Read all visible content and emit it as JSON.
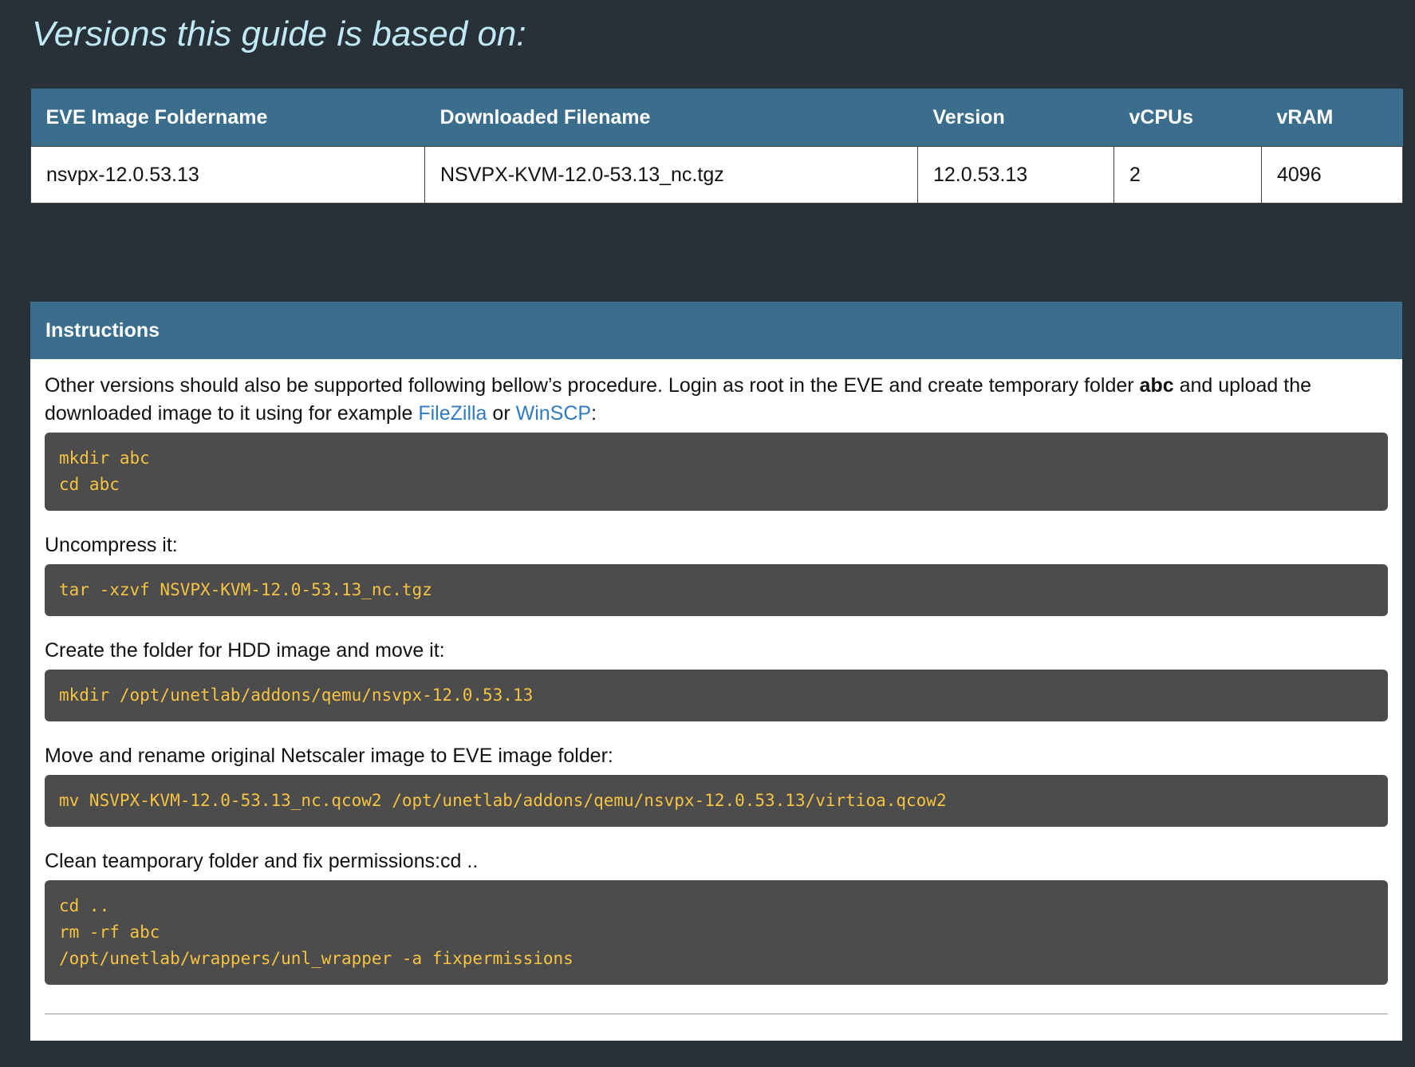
{
  "heading": "Versions this guide is based on:",
  "table": {
    "headers": [
      "EVE Image Foldername",
      "Downloaded Filename",
      "Version",
      "vCPUs",
      "vRAM"
    ],
    "rows": [
      [
        "nsvpx-12.0.53.13",
        "NSVPX-KVM-12.0-53.13_nc.tgz",
        "12.0.53.13",
        "2",
        "4096"
      ]
    ]
  },
  "instructions": {
    "title": "Instructions",
    "intro": {
      "text1": "Other versions should also be supported following bellow’s procedure. Login as root in the EVE and create temporary folder ",
      "bold": "abc",
      "text2": " and upload the downloaded image to it using for example ",
      "link1": "FileZilla",
      "text3": " or ",
      "link2": "WinSCP",
      "text4": ":"
    },
    "code1": [
      "mkdir abc",
      "cd abc"
    ],
    "step2": "Uncompress it:",
    "code2": [
      "tar -xzvf NSVPX-KVM-12.0-53.13_nc.tgz"
    ],
    "step3": "Create the folder for HDD image and move it:",
    "code3": [
      "mkdir /opt/unetlab/addons/qemu/nsvpx-12.0.53.13"
    ],
    "step4": "Move and rename original Netscaler image to EVE image folder:",
    "code4": [
      "mv NSVPX-KVM-12.0-53.13_nc.qcow2 /opt/unetlab/addons/qemu/nsvpx-12.0.53.13/virtioa.qcow2"
    ],
    "step5": "Clean teamporary folder and fix permissions:cd ..",
    "code5": [
      "cd ..",
      "rm -rf abc",
      "/opt/unetlab/wrappers/unl_wrapper -a fixpermissions"
    ]
  },
  "colors": {
    "background": "#283038",
    "header_bar": "#3b6d8c",
    "heading_text": "#bfe9f5",
    "code_bg": "#4c4c4c",
    "code_text": "#f6c342",
    "link": "#2f7bc0"
  }
}
